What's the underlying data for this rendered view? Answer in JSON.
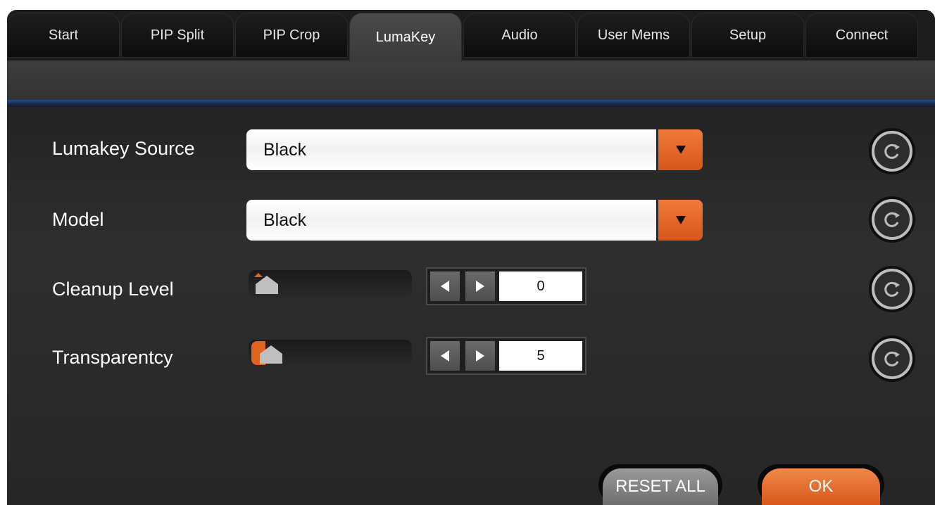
{
  "tabs": [
    {
      "label": "Start",
      "active": false
    },
    {
      "label": "PIP Split",
      "active": false
    },
    {
      "label": "PIP Crop",
      "active": false
    },
    {
      "label": "LumaKey",
      "active": true
    },
    {
      "label": "Audio",
      "active": false
    },
    {
      "label": "User Mems",
      "active": false
    },
    {
      "label": "Setup",
      "active": false
    },
    {
      "label": "Connect",
      "active": false
    }
  ],
  "settings": {
    "lumakey_source": {
      "label": "Lumakey Source",
      "value": "Black"
    },
    "model": {
      "label": "Model",
      "value": "Black"
    },
    "cleanup_level": {
      "label": "Cleanup Level",
      "value": "0"
    },
    "transparency": {
      "label": "Transparentcy",
      "value": "5"
    }
  },
  "footer": {
    "reset_all_label": "RESET ALL",
    "ok_label": "OK"
  },
  "colors": {
    "accent": "#e0641e",
    "background": "#2e2e2e",
    "tab_separator": "#2a4d8c"
  },
  "icons": {
    "dropdown": "triangle-down-icon",
    "reset": "refresh-icon",
    "step_left": "triangle-left-icon",
    "step_right": "triangle-right-icon"
  }
}
